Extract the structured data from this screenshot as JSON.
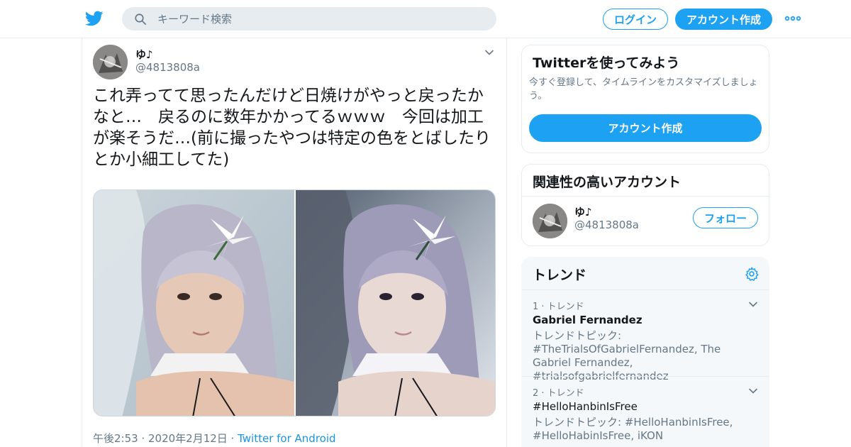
{
  "header": {
    "search_placeholder": "キーワード検索",
    "login_label": "ログイン",
    "signup_label": "アカウント作成",
    "brand_color": "#1da1f2",
    "icons": [
      "twitter-bird-icon",
      "search-icon",
      "more-dots-icon"
    ]
  },
  "tweet": {
    "author_name": "ゆ♪",
    "author_handle": "@4813808a",
    "text": "これ弄ってて思ったんだけど日焼けがやっと戻ったかなと…　戻るのに数年かかってるｗｗｗ　今回は加工が楽そうだ…(前に撮ったやつは特定の色をとばしたりとか小細工してた)",
    "timestamp": "午後2:53 · 2020年2月12日 · ",
    "source": "Twitter for Android",
    "photo_count": 2
  },
  "sidebar": {
    "try_card": {
      "title": "Twitterを使ってみよう",
      "description": "今すぐ登録して、タイムラインをカスタマイズしましょう。",
      "button_label": "アカウント作成"
    },
    "related_card": {
      "title": "関連性の高いアカウント",
      "account_name": "ゆ♪",
      "account_handle": "@4813808a",
      "follow_label": "フォロー"
    },
    "trends_card": {
      "title": "トレンド",
      "items": [
        {
          "rank": "1 · トレンド",
          "name": "Gabriel Fernandez",
          "description": "トレンドトピック: #TheTrialsOfGabrielFernandez, The Gabriel Fernandez, #trialsofgabrielfernandez"
        },
        {
          "rank": "2 · トレンド",
          "name": "#HelloHanbinIsFree",
          "description": "トレンドトピック: #HelloHanbinIsFree, #HelloHabinIsFree, iKON"
        }
      ]
    }
  }
}
